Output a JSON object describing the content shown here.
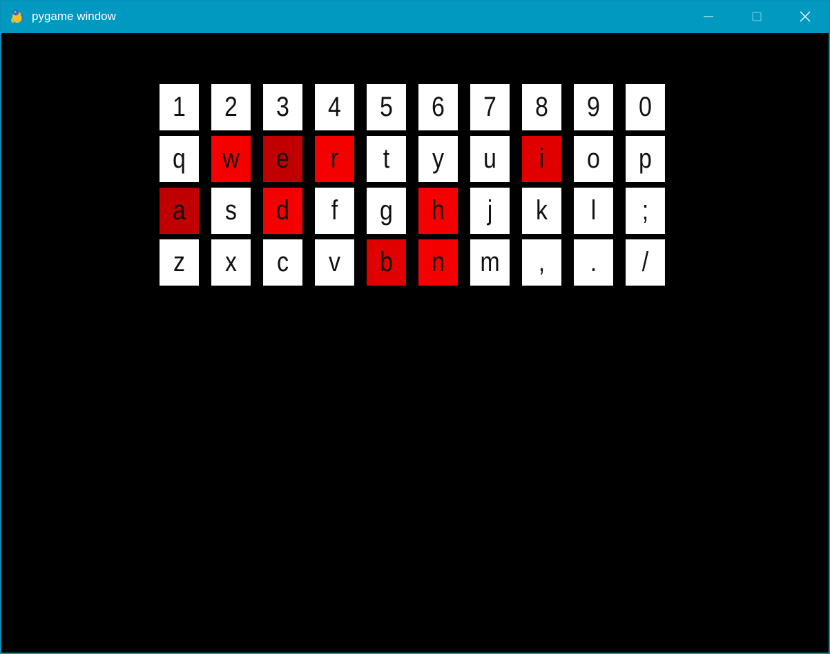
{
  "window": {
    "title": "pygame window",
    "icon": "pygame-snake-icon",
    "controls": {
      "minimize_icon": "minimize-icon",
      "maximize_icon": "maximize-icon",
      "close_icon": "close-icon"
    },
    "colors": {
      "titlebar": "#0199bf",
      "canvas": "#000000",
      "key_default": "#ffffff"
    }
  },
  "keyboard": {
    "rows": [
      [
        {
          "label": "1",
          "color": "#ffffff"
        },
        {
          "label": "2",
          "color": "#ffffff"
        },
        {
          "label": "3",
          "color": "#ffffff"
        },
        {
          "label": "4",
          "color": "#ffffff"
        },
        {
          "label": "5",
          "color": "#ffffff"
        },
        {
          "label": "6",
          "color": "#ffffff"
        },
        {
          "label": "7",
          "color": "#ffffff"
        },
        {
          "label": "8",
          "color": "#ffffff"
        },
        {
          "label": "9",
          "color": "#ffffff"
        },
        {
          "label": "0",
          "color": "#ffffff"
        }
      ],
      [
        {
          "label": "q",
          "color": "#ffffff"
        },
        {
          "label": "w",
          "color": "#f50000"
        },
        {
          "label": "e",
          "color": "#c00000"
        },
        {
          "label": "r",
          "color": "#f50000"
        },
        {
          "label": "t",
          "color": "#ffffff"
        },
        {
          "label": "y",
          "color": "#ffffff"
        },
        {
          "label": "u",
          "color": "#ffffff"
        },
        {
          "label": "i",
          "color": "#e00000"
        },
        {
          "label": "o",
          "color": "#ffffff"
        },
        {
          "label": "p",
          "color": "#ffffff"
        }
      ],
      [
        {
          "label": "a",
          "color": "#c00000"
        },
        {
          "label": "s",
          "color": "#ffffff"
        },
        {
          "label": "d",
          "color": "#f50000"
        },
        {
          "label": "f",
          "color": "#ffffff"
        },
        {
          "label": "g",
          "color": "#ffffff"
        },
        {
          "label": "h",
          "color": "#f50000"
        },
        {
          "label": "j",
          "color": "#ffffff"
        },
        {
          "label": "k",
          "color": "#ffffff"
        },
        {
          "label": "l",
          "color": "#ffffff"
        },
        {
          "label": ";",
          "color": "#ffffff"
        }
      ],
      [
        {
          "label": "z",
          "color": "#ffffff"
        },
        {
          "label": "x",
          "color": "#ffffff"
        },
        {
          "label": "c",
          "color": "#ffffff"
        },
        {
          "label": "v",
          "color": "#ffffff"
        },
        {
          "label": "b",
          "color": "#e00000"
        },
        {
          "label": "n",
          "color": "#f50000"
        },
        {
          "label": "m",
          "color": "#ffffff"
        },
        {
          "label": ",",
          "color": "#ffffff"
        },
        {
          "label": ".",
          "color": "#ffffff"
        },
        {
          "label": "/",
          "color": "#ffffff"
        }
      ]
    ]
  }
}
